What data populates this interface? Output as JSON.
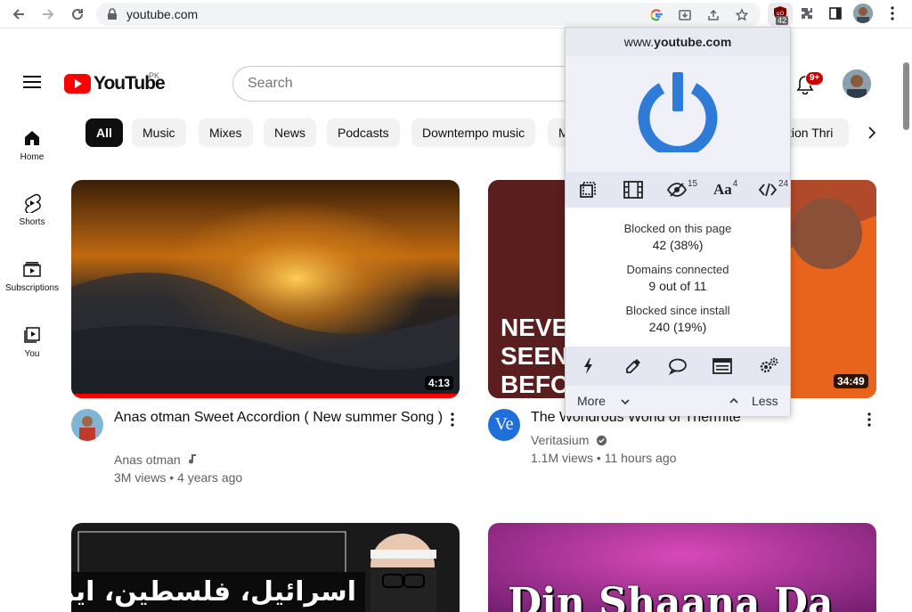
{
  "browser": {
    "url": "youtube.com",
    "ublock_badge": "42"
  },
  "youtube": {
    "logo_text": "YouTube",
    "country_code": "PK",
    "search_placeholder": "Search",
    "notifications_badge": "9+",
    "sidebar": [
      {
        "label": "Home",
        "icon": "home-icon"
      },
      {
        "label": "Shorts",
        "icon": "shorts-icon"
      },
      {
        "label": "Subscriptions",
        "icon": "subscriptions-icon"
      },
      {
        "label": "You",
        "icon": "you-icon"
      }
    ],
    "chips": [
      "All",
      "Music",
      "Mixes",
      "News",
      "Podcasts",
      "Downtempo music",
      "M",
      "tion Thri"
    ],
    "videos": [
      {
        "title": "Anas otman Sweet Accordion ( New summer Song )",
        "channel": "Anas otman",
        "stats": "3M views • 4 years ago",
        "duration": "4:13"
      },
      {
        "title": "The Wondrous World of Thermite",
        "channel": "Veritasium",
        "channel_avatar_text": "Ve",
        "stats": "1.1M views • 11 hours ago",
        "duration": "34:49",
        "thumb_text": "NEVE SEEN BEFO"
      },
      {
        "title": "",
        "thumb_text": "اسرائیل، فلسطین، ایران جنگ"
      },
      {
        "title": "",
        "thumb_text": "Din Shaana Da"
      }
    ]
  },
  "ublock": {
    "host_prefix": "www.",
    "host_domain": "youtube.com",
    "tools": [
      {
        "icon": "element-zapper-icon",
        "count": ""
      },
      {
        "icon": "media-icon",
        "count": ""
      },
      {
        "icon": "cosmetic-filter-icon",
        "count": "15"
      },
      {
        "icon": "font-icon",
        "count": "4"
      },
      {
        "icon": "script-icon",
        "count": "24"
      }
    ],
    "stats": [
      {
        "label": "Blocked on this page",
        "value": "42 (38%)"
      },
      {
        "label": "Domains connected",
        "value": "9 out of 11"
      },
      {
        "label": "Blocked since install",
        "value": "240 (19%)"
      }
    ],
    "font_label": "Aa",
    "more_label": "More",
    "less_label": "Less"
  },
  "colors": {
    "ublock_power": "#2f7bd8",
    "yt_red": "#ff0000",
    "progress_red": "#ff0000"
  }
}
